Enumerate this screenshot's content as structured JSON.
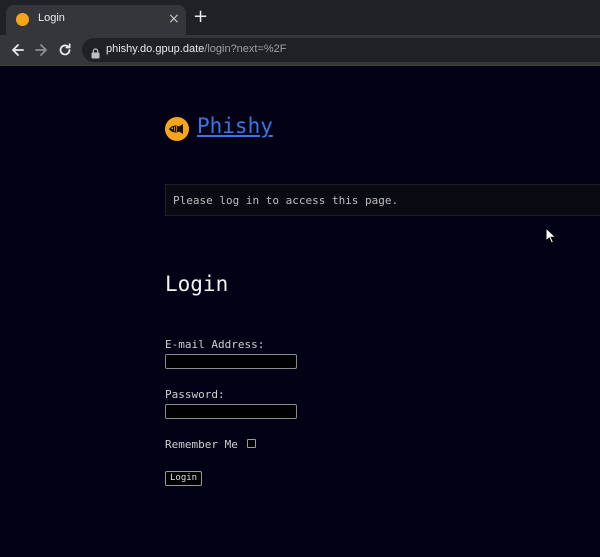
{
  "browser": {
    "tab": {
      "title": "Login",
      "close_glyph": "×"
    },
    "new_tab_glyph": "+",
    "address": {
      "host": "phishy.do.gpup.date",
      "path": "/login?next=%2F"
    },
    "icons": [
      "back-arrow-icon",
      "forward-arrow-icon",
      "reload-icon",
      "lock-icon"
    ]
  },
  "site": {
    "brand_name": "Phishy",
    "logo_icon": "fish-logo-icon",
    "link_color": "#3b75e5",
    "logo_color": "#f6a51a"
  },
  "flash": {
    "message": "Please log in to access this page."
  },
  "form": {
    "title": "Login",
    "email_label": "E-mail Address:",
    "email_value": "",
    "password_label": "Password:",
    "password_value": "",
    "remember_label": "Remember Me",
    "remember_checked": false,
    "submit_label": "Login"
  }
}
